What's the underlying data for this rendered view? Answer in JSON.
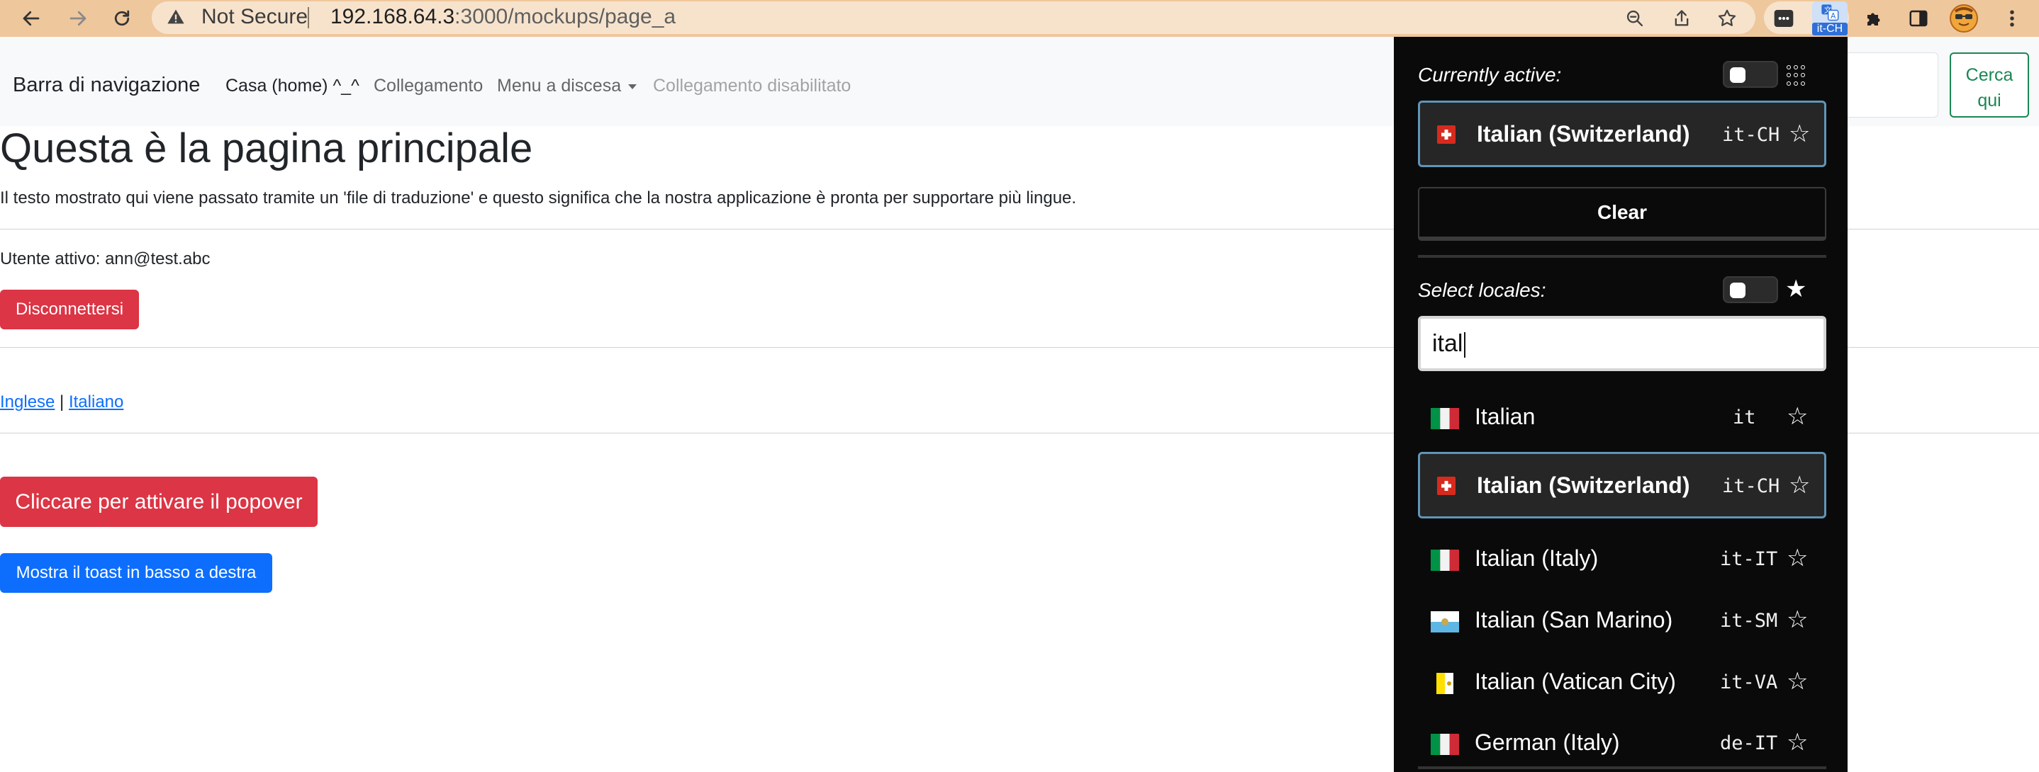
{
  "browser": {
    "security_label": "Not Secure",
    "url_host": "192.168.64.3",
    "url_path": ":3000/mockups/page_a",
    "ext_badge": "it-CH"
  },
  "navbar": {
    "brand": "Barra di navigazione",
    "links": [
      "Casa (home) ^_^",
      "Collegamento",
      "Menu a discesa",
      "Collegamento disabilitato"
    ],
    "search_button": [
      "Cerca",
      "qui"
    ]
  },
  "main": {
    "title": "Questa è la pagina principale",
    "intro": "Il testo mostrato qui viene passato tramite un 'file di traduzione' e questo significa che la nostra applicazione è pronta per supportare più lingue.",
    "user_line": "Utente attivo: ann@test.abc",
    "logout_button": "Disconnettersi",
    "lang_link_en": "Inglese",
    "lang_separator": " | ",
    "lang_link_it": "Italiano",
    "popover_button": "Cliccare per attivare il popover",
    "toast_button": "Mostra il toast in basso a destra"
  },
  "popup": {
    "currently_active_label": "Currently active:",
    "active_locale": {
      "name": "Italian (Switzerland)",
      "code": "it-CH",
      "flag": "switzerland-flag"
    },
    "clear_button": "Clear",
    "select_label": "Select locales:",
    "search_value": "ital",
    "results": [
      {
        "name": "Italian",
        "code": "it",
        "flag": "italy-flag",
        "selected": false
      },
      {
        "name": "Italian (Switzerland)",
        "code": "it-CH",
        "flag": "switzerland-flag",
        "selected": true
      },
      {
        "name": "Italian (Italy)",
        "code": "it-IT",
        "flag": "italy-flag",
        "selected": false
      },
      {
        "name": "Italian (San Marino)",
        "code": "it-SM",
        "flag": "san-marino-flag",
        "selected": false
      },
      {
        "name": "Italian (Vatican City)",
        "code": "it-VA",
        "flag": "vatican-flag",
        "selected": false
      },
      {
        "name": "German (Italy)",
        "code": "de-IT",
        "flag": "italy-flag",
        "selected": false
      }
    ]
  },
  "colors": {
    "chrome_bg": "#efc79c",
    "danger": "#dc3545",
    "primary": "#0d6efd",
    "success": "#198754",
    "popup_bg": "#0a0a0a",
    "selected_border": "#5f95b8"
  }
}
